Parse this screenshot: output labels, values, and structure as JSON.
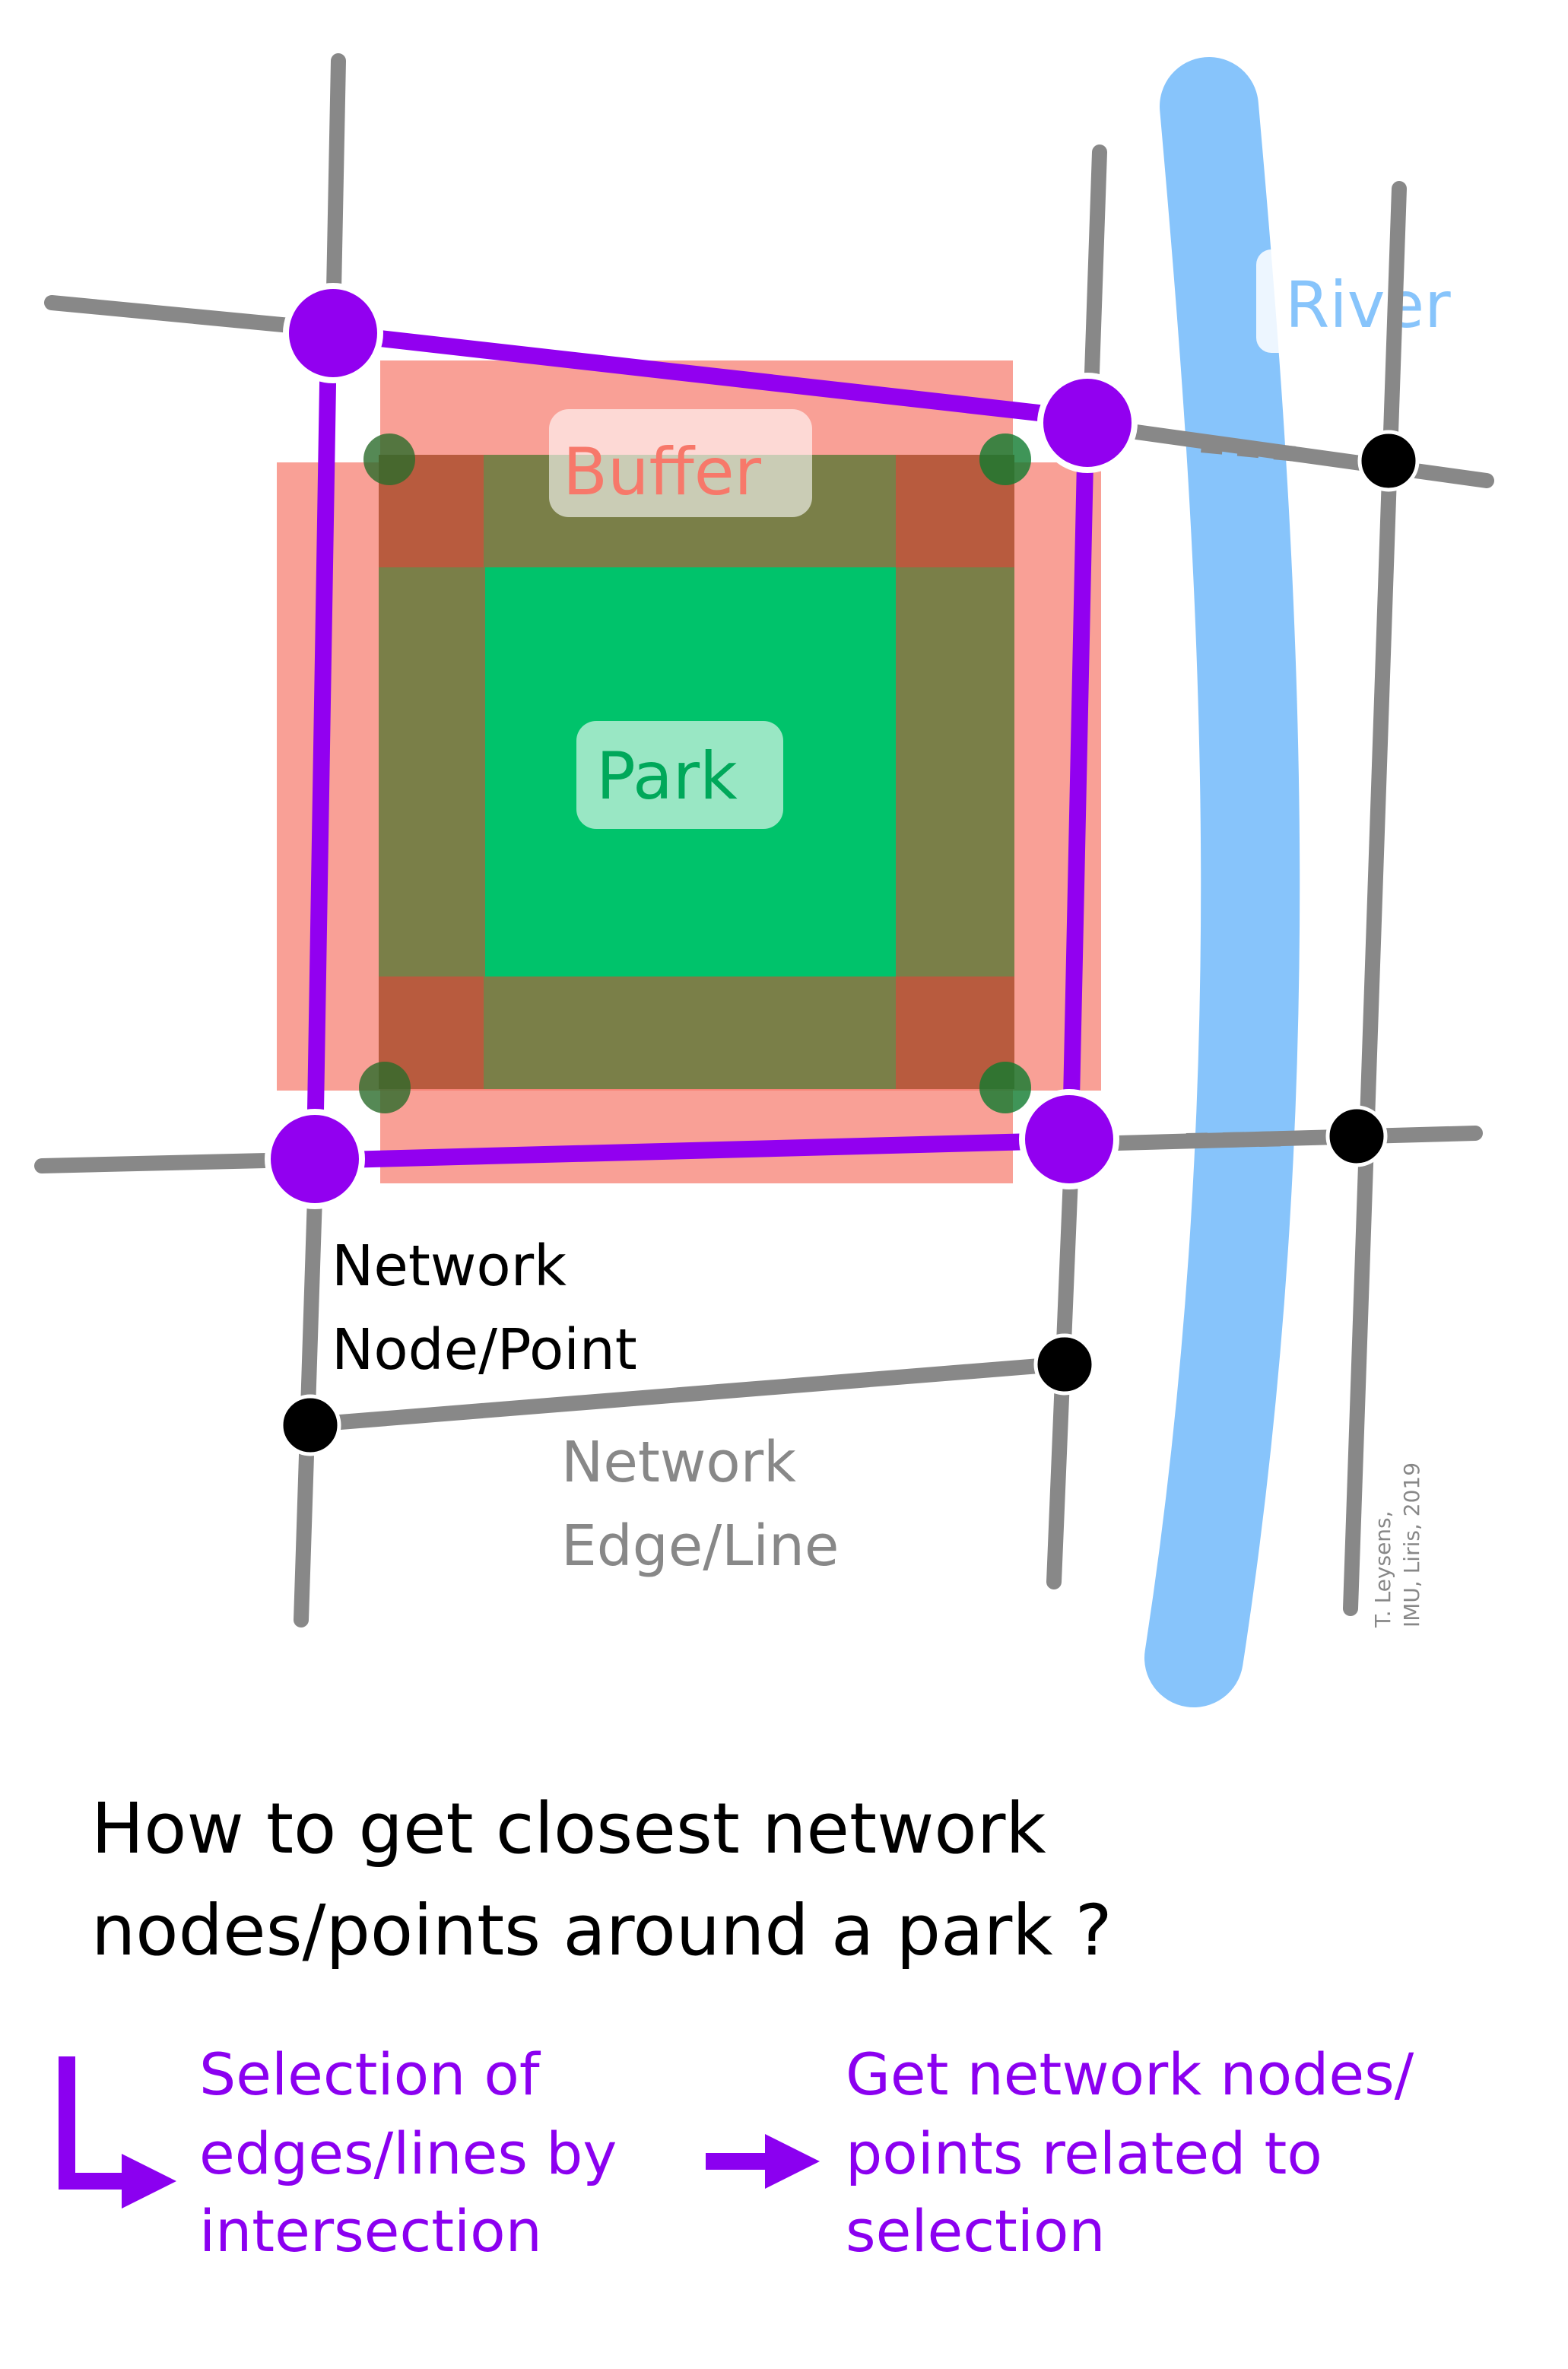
{
  "labels": {
    "river": "River",
    "buffer": "Buffer",
    "park": "Park",
    "node_point_line1": "Network",
    "node_point_line2": "Node/Point",
    "edge_line_line1": "Network",
    "edge_line_line2": "Edge/Line",
    "credit_line1": "T. Leysens,",
    "credit_line2": "IMU, Liris, 2019"
  },
  "question": {
    "line1": "How to get closest network",
    "line2": "nodes/points around a park ?"
  },
  "steps": [
    {
      "lines": [
        "Selection of",
        "edges/lines by",
        "intersection"
      ]
    },
    {
      "lines": [
        "Get network nodes/",
        "points related to",
        "selection"
      ]
    }
  ],
  "colors": {
    "road": "#888888",
    "river": "#87c4fb",
    "buffer": "#f7786a",
    "park_inner": "#00c36b",
    "park_border": "#7a7f48",
    "selection": "#9200f0",
    "node": "#000000",
    "step_text": "#8b00f0"
  },
  "icons": {
    "step_bullet": "corner-arrow-icon",
    "step_connector": "right-arrow-icon"
  }
}
